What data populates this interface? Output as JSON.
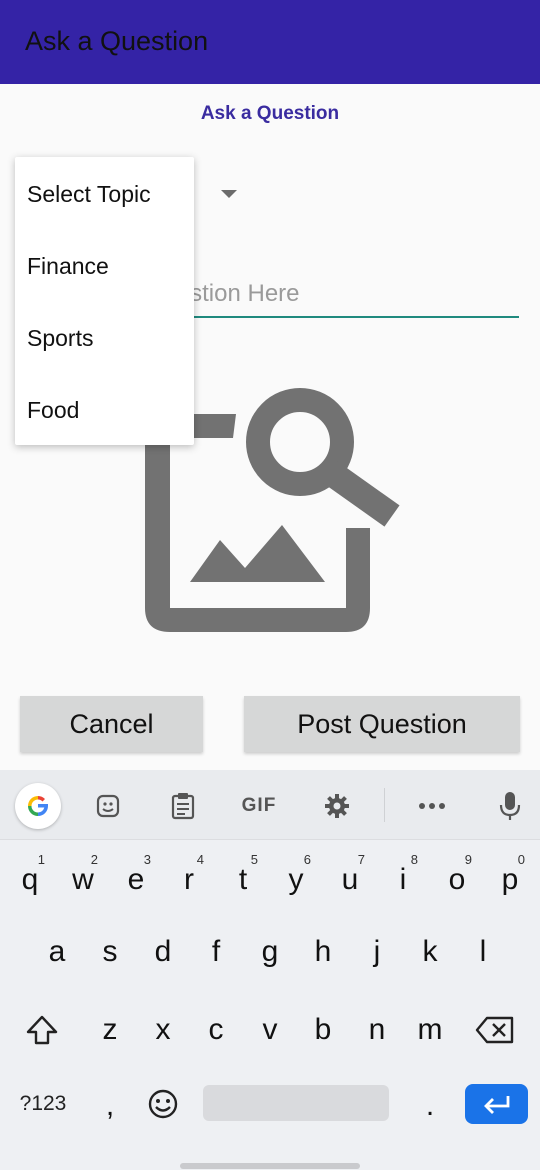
{
  "appbar": {
    "title": "Ask a Question"
  },
  "page": {
    "heading": "Ask a Question"
  },
  "topic_spinner": {
    "selected": "Select Topic"
  },
  "question_field": {
    "placeholder": "Enter Your Question Here",
    "value": ""
  },
  "image": {
    "icon": "image-search-icon"
  },
  "buttons": {
    "cancel": "Cancel",
    "post": "Post Question"
  },
  "dropdown": {
    "items": [
      "Select Topic",
      "Finance",
      "Sports",
      "Food"
    ]
  },
  "colors": {
    "appbar": "#3423a6",
    "heading": "#3a2ca0",
    "underline": "#1f8a7e",
    "enter_key": "#1a73e8"
  },
  "keyboard": {
    "toolbar": [
      "google-icon",
      "sticker-icon",
      "clipboard-icon",
      "GIF",
      "settings-icon",
      "more-icon",
      "mic-icon"
    ],
    "row1": [
      "q",
      "w",
      "e",
      "r",
      "t",
      "y",
      "u",
      "i",
      "o",
      "p"
    ],
    "row1_hints": [
      "1",
      "2",
      "3",
      "4",
      "5",
      "6",
      "7",
      "8",
      "9",
      "0"
    ],
    "row2": [
      "a",
      "s",
      "d",
      "f",
      "g",
      "h",
      "j",
      "k",
      "l"
    ],
    "row3": [
      "z",
      "x",
      "c",
      "v",
      "b",
      "n",
      "m"
    ],
    "symbols_key": "?123",
    "comma": ",",
    "period": "."
  }
}
